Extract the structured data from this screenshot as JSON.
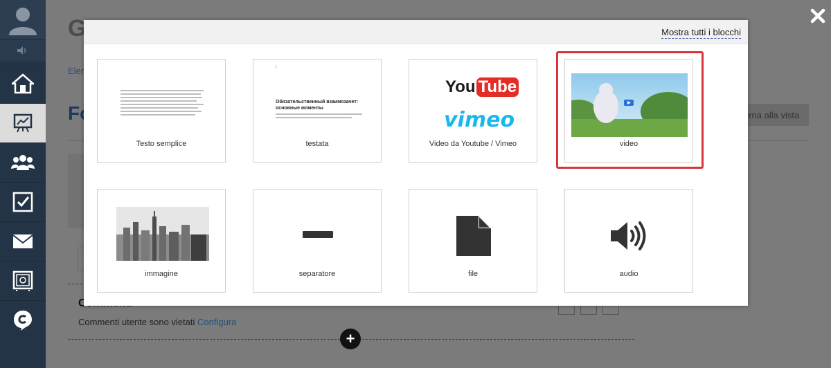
{
  "sidebar": {
    "items": [
      {
        "icon": "home-icon"
      },
      {
        "icon": "chart-icon",
        "active": true
      },
      {
        "icon": "users-icon"
      },
      {
        "icon": "checkbox-icon"
      },
      {
        "icon": "mail-icon"
      },
      {
        "icon": "safe-icon"
      },
      {
        "icon": "chat-icon"
      }
    ]
  },
  "background": {
    "title": "G",
    "breadcrumb": "Elen",
    "heading": "Fo",
    "return_button": "orna alla vista",
    "comments_title": "Commenti",
    "comments_text": "Commenti utente sono vietati",
    "comments_link": "Configura",
    "add_symbol": "+"
  },
  "modal": {
    "show_all": "Mostra tutti i blocchi",
    "tiles": [
      {
        "label": "Testo semplice",
        "icon": "text-preview"
      },
      {
        "label": "testata",
        "icon": "header-preview",
        "preview_heading": "Обязательственный взаимозачет: основные моменты"
      },
      {
        "label": "Video da Youtube / Vimeo",
        "icon": "youtube-vimeo-logos",
        "brand_youtube_a": "You",
        "brand_youtube_b": "Tube",
        "brand_vimeo": "vimeo"
      },
      {
        "label": "video",
        "icon": "video-thumbnail",
        "highlighted": true
      },
      {
        "label": "immagine",
        "icon": "city-image"
      },
      {
        "label": "separatore",
        "icon": "separator-icon"
      },
      {
        "label": "file",
        "icon": "file-icon"
      },
      {
        "label": "audio",
        "icon": "speaker-icon"
      }
    ]
  },
  "colors": {
    "sidebar_bg": "#243447",
    "highlight": "#d9343a",
    "youtube_red": "#e52d27",
    "vimeo_blue": "#1ab7ea",
    "link_underline": "#3a52a8"
  }
}
